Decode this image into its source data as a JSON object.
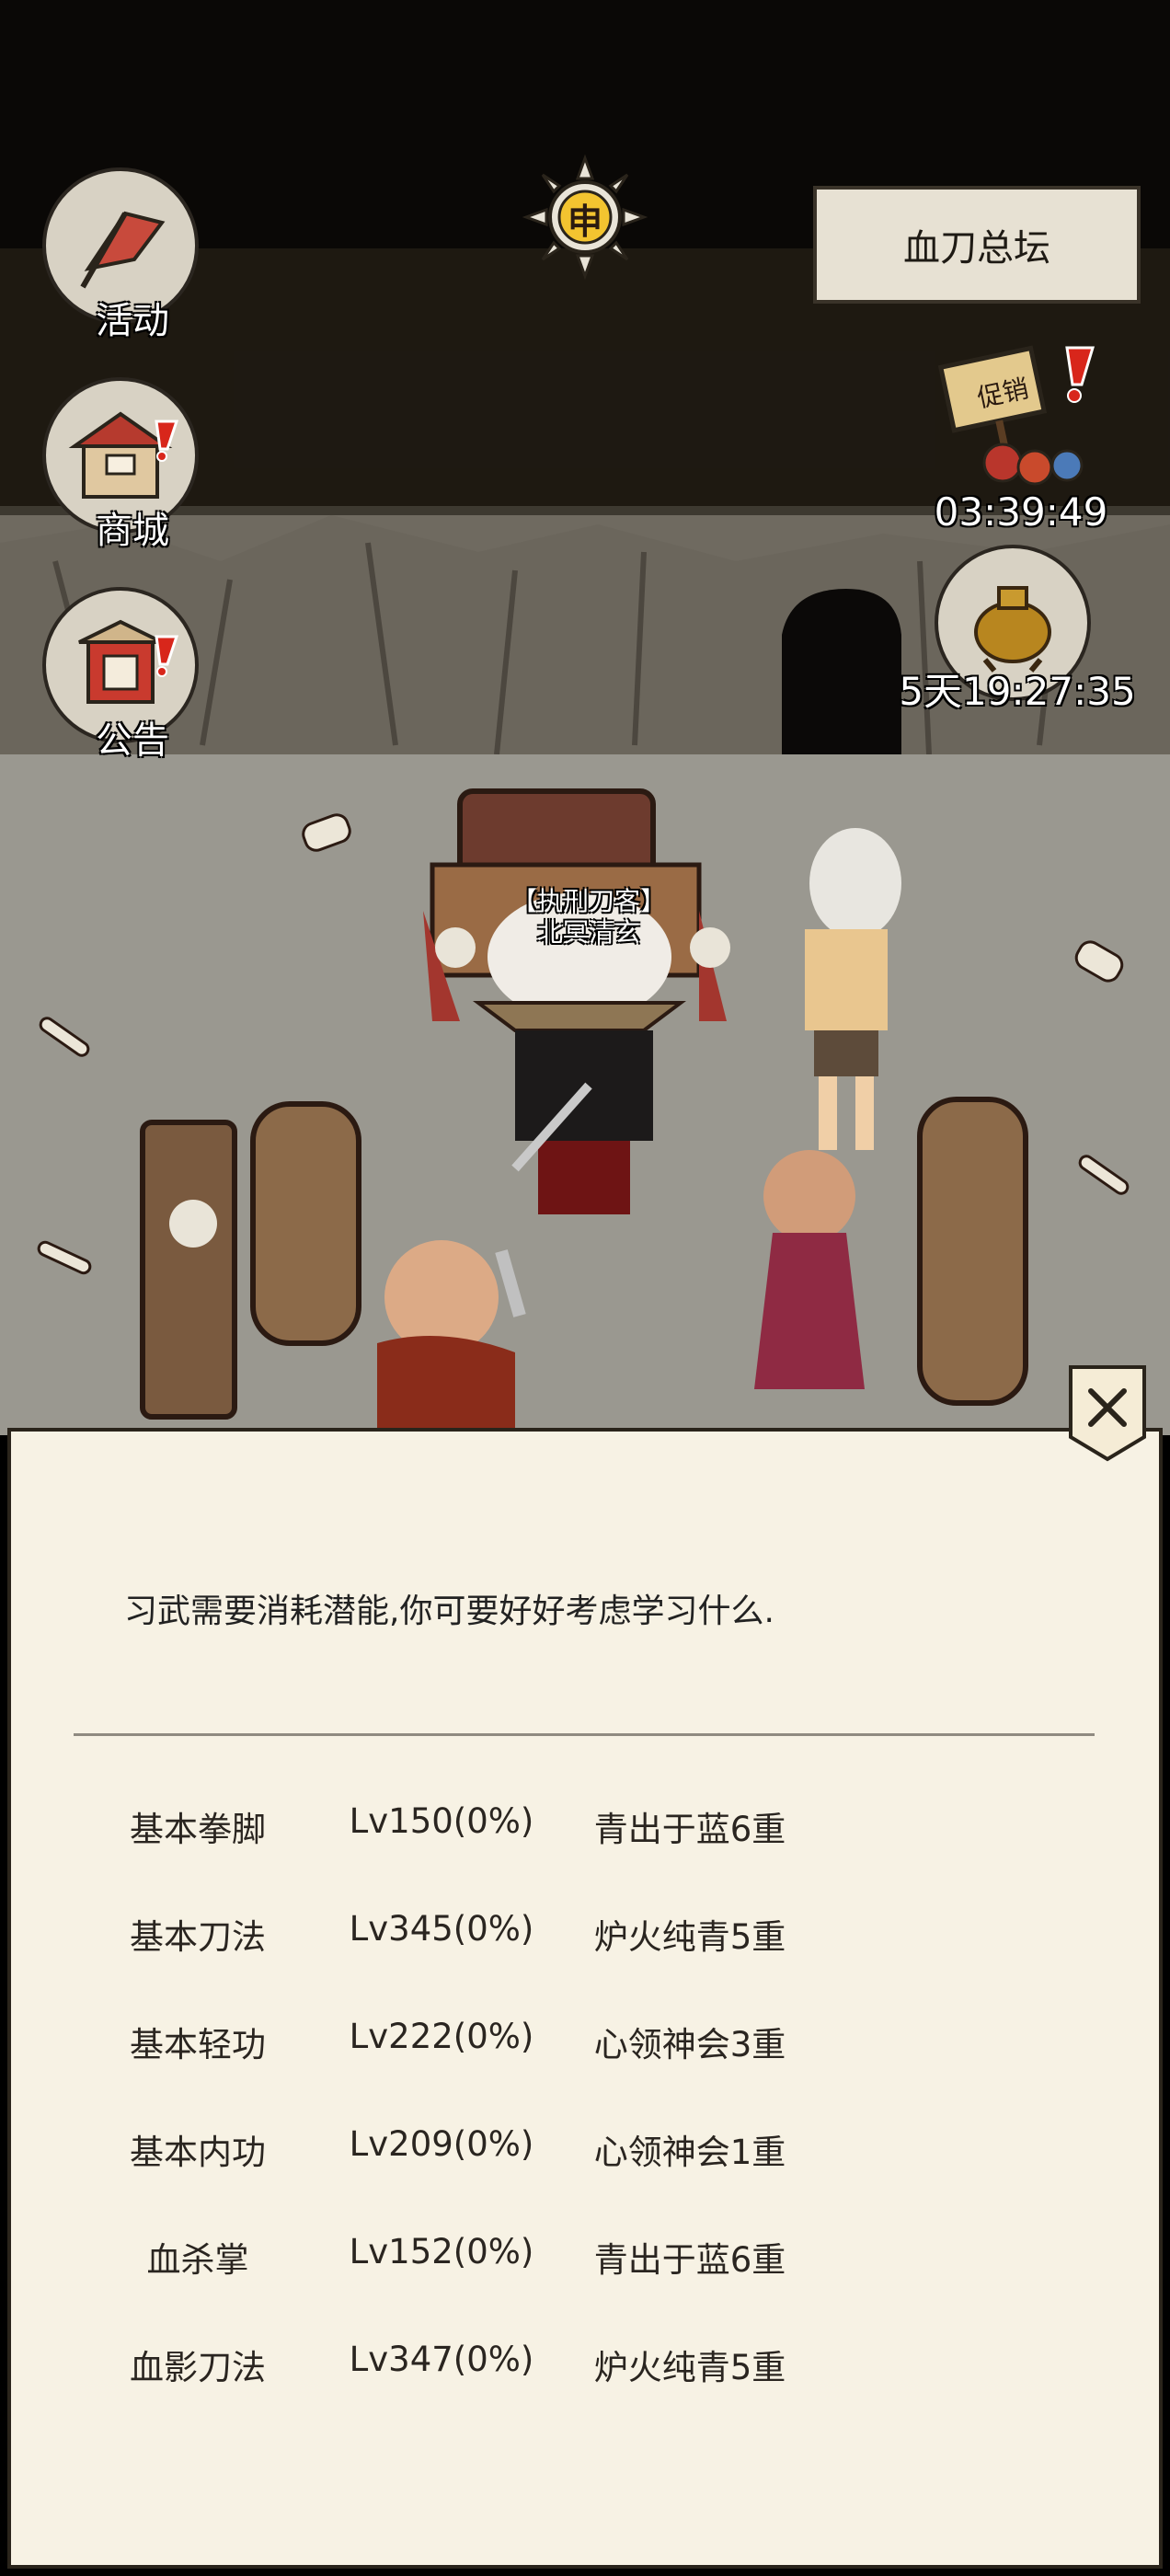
{
  "sidebar": {
    "items": [
      {
        "label": "活动",
        "icon": "banner-icon",
        "alert": false
      },
      {
        "label": "商城",
        "icon": "shop-icon",
        "alert": true
      },
      {
        "label": "公告",
        "icon": "notice-board-icon",
        "alert": true
      }
    ]
  },
  "clock": {
    "hour_char": "申",
    "icon": "sun-clock-icon"
  },
  "location": {
    "name": "血刀总坛"
  },
  "promo": {
    "icon": "promotion-icon",
    "sign": "促销",
    "timer": "03:39:49"
  },
  "treasure": {
    "icon": "golden-censer-icon",
    "timer": "5天19:27:35"
  },
  "npc": {
    "title": "【执刑刀客】",
    "name": "北冥清玄"
  },
  "dialog": {
    "prompt": "习武需要消耗潜能,你可要好好考虑学习什么.",
    "skills": [
      {
        "name": "基本拳脚",
        "level": "Lv150(0%)",
        "stage": "青出于蓝6重"
      },
      {
        "name": "基本刀法",
        "level": "Lv345(0%)",
        "stage": "炉火纯青5重"
      },
      {
        "name": "基本轻功",
        "level": "Lv222(0%)",
        "stage": "心领神会3重"
      },
      {
        "name": "基本内功",
        "level": "Lv209(0%)",
        "stage": "心领神会1重"
      },
      {
        "name": "血杀掌",
        "level": "Lv152(0%)",
        "stage": "青出于蓝6重"
      },
      {
        "name": "血影刀法",
        "level": "Lv347(0%)",
        "stage": "炉火纯青5重"
      }
    ],
    "close_icon": "close-icon"
  },
  "colors": {
    "panel_bg": "#f7f2e4",
    "alert_red": "#d8261b",
    "location_bg": "#e7e1d3"
  }
}
